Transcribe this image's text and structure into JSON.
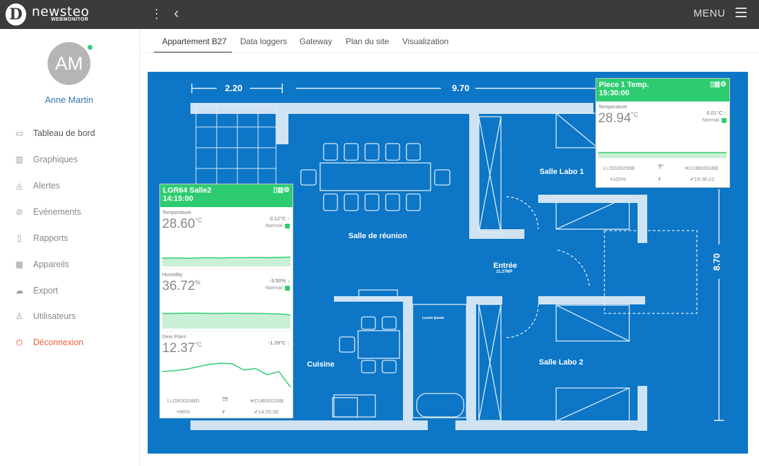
{
  "app": {
    "brand": "newsteo",
    "brand_sub": "WEBMONITOR",
    "logo_letter": "D",
    "menu_label": "MENU"
  },
  "user": {
    "initials": "AM",
    "name": "Anne Martin",
    "status_color": "#2ecc71"
  },
  "sidebar": {
    "items": [
      {
        "label": "Tableau de bord",
        "icon": "monitor-icon"
      },
      {
        "label": "Graphiques",
        "icon": "bar-chart-icon"
      },
      {
        "label": "Alertes",
        "icon": "bell-icon"
      },
      {
        "label": "Evénements",
        "icon": "paperclip-icon"
      },
      {
        "label": "Rapports",
        "icon": "document-icon"
      },
      {
        "label": "Appareils",
        "icon": "grid-icon"
      },
      {
        "label": "Export",
        "icon": "cloud-download-icon"
      },
      {
        "label": "Utilisateurs",
        "icon": "user-icon"
      },
      {
        "label": "Déconnexion",
        "icon": "power-icon"
      }
    ]
  },
  "tabs": [
    {
      "label": "Appartement B27",
      "active": true
    },
    {
      "label": "Data loggers"
    },
    {
      "label": "Gateway"
    },
    {
      "label": "Plan du site"
    },
    {
      "label": "Visualization"
    }
  ],
  "plan": {
    "dims": {
      "width_left": "2.20",
      "width_main": "9.70",
      "height": "8.70"
    },
    "rooms": {
      "meeting": "Salle de réunion",
      "entry": "Entrée",
      "entry_sub": "11.27MP",
      "lab1": "Salle Labo 1",
      "lab2": "Salle Labo 2",
      "kitchen": "Cuisine",
      "small_label": "Lorem Ipsum"
    },
    "colors": {
      "background": "#0d76c6",
      "walls": "#cfe3f3"
    }
  },
  "card_left": {
    "title": "LGR64 Salle2",
    "time": "14:15:00",
    "metrics": [
      {
        "name": "Temperature",
        "value": "28.60",
        "unit": "°C",
        "delta": "0.12°C",
        "arrow": "↑",
        "status": "Normal",
        "series": [
          0.3,
          0.31,
          0.3,
          0.31,
          0.32,
          0.31,
          0.32,
          0.32,
          0.33,
          0.32,
          0.33,
          0.34
        ]
      },
      {
        "name": "Humidity",
        "value": "36.72",
        "unit": "%",
        "delta": "-3.50%",
        "arrow": "↓",
        "status": "Normal",
        "series": [
          0.55,
          0.55,
          0.56,
          0.56,
          0.55,
          0.55,
          0.56,
          0.55,
          0.55,
          0.54,
          0.53,
          0.5
        ]
      },
      {
        "name": "Dew Point",
        "value": "12.37",
        "unit": "°C",
        "delta": "-1.29°C",
        "arrow": "↓",
        "status": "",
        "series": [
          0.55,
          0.58,
          0.62,
          0.7,
          0.78,
          0.82,
          0.8,
          0.6,
          0.65,
          0.45,
          0.55,
          0.05
        ]
      }
    ],
    "footer": {
      "logger": "LGR0024BD",
      "interval": "15",
      "interval_unit": "min",
      "gateway": "CUB0001BB",
      "battery": "96%",
      "count": "7",
      "last": "14:25:38"
    }
  },
  "card_right": {
    "title": "Piece 1 Temp.",
    "time": "15:30:00",
    "metrics": [
      {
        "name": "Temperature",
        "value": "28.94",
        "unit": "°C",
        "delta": "0.01°C",
        "arrow": "↑",
        "status": "Normal",
        "series": [
          0.2,
          0.2,
          0.2,
          0.2,
          0.2,
          0.2,
          0.2,
          0.2,
          0.2,
          0.2,
          0.2,
          0.2
        ]
      }
    ],
    "footer": {
      "logger": "LOG00255B",
      "interval": "5",
      "interval_unit": "min",
      "gateway": "CUB0001BB",
      "battery": "100%",
      "count": "7",
      "last": "15:36:21"
    }
  }
}
